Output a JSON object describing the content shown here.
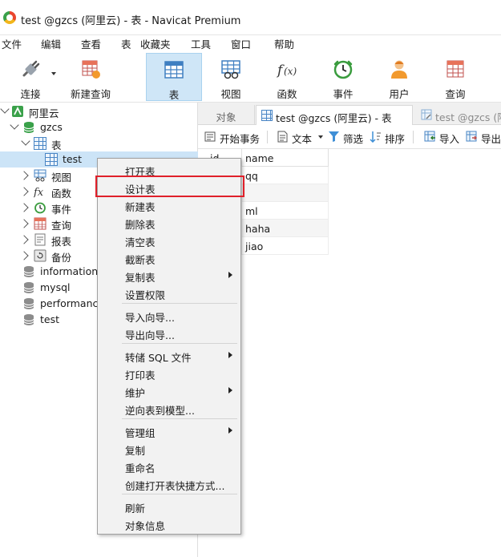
{
  "window": {
    "title": "test @gzcs (阿里云) - 表 - Navicat Premium"
  },
  "menu": [
    "文件",
    "编辑",
    "查看",
    "表",
    "收藏夹",
    "工具",
    "窗口",
    "帮助"
  ],
  "toolbar": [
    {
      "label": "连接",
      "icon": "plug-icon"
    },
    {
      "label": "新建查询",
      "icon": "new-query-icon"
    },
    {
      "label": "表",
      "icon": "table-icon",
      "active": true
    },
    {
      "label": "视图",
      "icon": "view-icon"
    },
    {
      "label": "函数",
      "icon": "function-icon"
    },
    {
      "label": "事件",
      "icon": "clock-icon"
    },
    {
      "label": "用户",
      "icon": "user-icon"
    },
    {
      "label": "查询",
      "icon": "query-icon"
    }
  ],
  "tree": {
    "connection": "阿里云",
    "database": "gzcs",
    "tables_node": "表",
    "selected_table": "test",
    "nodes": [
      "视图",
      "函数",
      "事件",
      "查询",
      "报表",
      "备份"
    ],
    "other_databases": [
      "information_",
      "mysql",
      "performance",
      "test"
    ]
  },
  "tabs": {
    "objects": "对象",
    "active": "test @gzcs (阿里云) - 表",
    "inactive": "test @gzcs (阿"
  },
  "subtoolbar": {
    "begin_transaction": "开始事务",
    "text": "文本",
    "filter": "筛选",
    "sort": "排序",
    "import": "导入",
    "export": "导出"
  },
  "grid": {
    "columns": [
      "id",
      "name"
    ],
    "rows": [
      [
        "",
        "qq"
      ],
      [
        "",
        ""
      ],
      [
        "",
        "ml"
      ],
      [
        "",
        "haha"
      ],
      [
        "",
        "jiao"
      ]
    ]
  },
  "context_menu": {
    "groups": [
      [
        {
          "label": "打开表"
        },
        {
          "label": "设计表",
          "highlighted": true
        },
        {
          "label": "新建表"
        },
        {
          "label": "删除表"
        },
        {
          "label": "清空表"
        },
        {
          "label": "截断表"
        },
        {
          "label": "复制表",
          "submenu": true
        },
        {
          "label": "设置权限"
        }
      ],
      [
        {
          "label": "导入向导..."
        },
        {
          "label": "导出向导..."
        }
      ],
      [
        {
          "label": "转储 SQL 文件",
          "submenu": true
        },
        {
          "label": "打印表"
        },
        {
          "label": "维护",
          "submenu": true
        },
        {
          "label": "逆向表到模型..."
        }
      ],
      [
        {
          "label": "管理组",
          "submenu": true
        },
        {
          "label": "复制"
        },
        {
          "label": "重命名"
        },
        {
          "label": "创建打开表快捷方式..."
        }
      ],
      [
        {
          "label": "刷新"
        },
        {
          "label": "对象信息"
        }
      ]
    ]
  },
  "colors": {
    "active_tool_bg": "#cfe6f7",
    "selection": "#cce4f7",
    "highlight_border": "#e0202a",
    "db_icon": "#3aa14a"
  }
}
